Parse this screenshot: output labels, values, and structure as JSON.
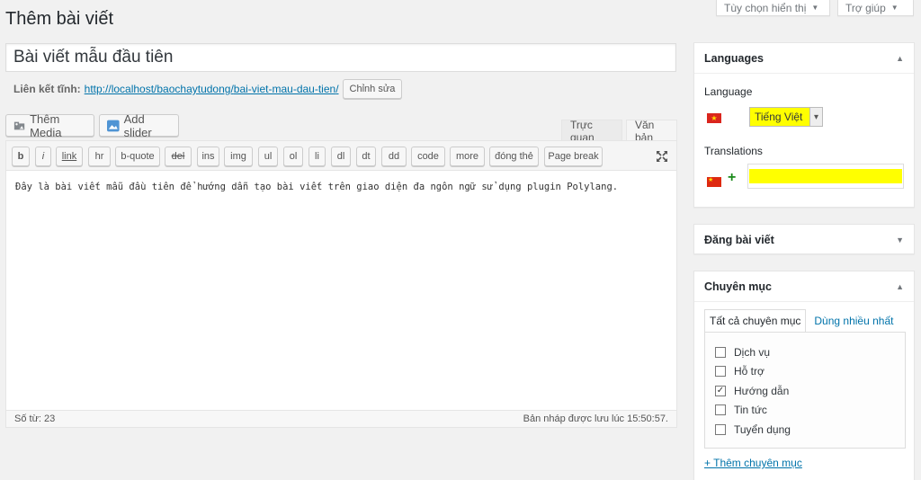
{
  "screen_meta": {
    "options_label": "Tùy chọn hiển thị",
    "help_label": "Trợ giúp"
  },
  "page": {
    "title": "Thêm bài viết"
  },
  "post": {
    "title": "Bài viết mẫu đầu tiên",
    "permalink_label": "Liên kết tĩnh:",
    "permalink_base": "http://localhost/baochaytudong/",
    "permalink_slug": "bai-viet-mau-dau-tien",
    "permalink_trailing": "/",
    "edit_button": "Chỉnh sửa"
  },
  "media_buttons": {
    "add_media": "Thêm Media",
    "add_slider": "Add slider"
  },
  "editor": {
    "tab_visual": "Trực quan",
    "tab_text": "Văn bản",
    "quicktags": [
      "b",
      "i",
      "link",
      "hr",
      "b-quote",
      "del",
      "ins",
      "img",
      "ul",
      "ol",
      "li",
      "dl",
      "dt",
      "dd",
      "code",
      "more",
      "đóng thẻ",
      "Page break"
    ],
    "content": "Đây là bài viết mẫu đầu tiên để hướng dẫn tạo bài viết trên giao diện đa ngôn ngữ sử dụng plugin Polylang.",
    "word_count": "Số từ: 23",
    "draft_saved": "Bản nháp được lưu lúc 15:50:57."
  },
  "languages_box": {
    "title": "Languages",
    "language_label": "Language",
    "selected_language": "Tiếng Việt",
    "translations_label": "Translations"
  },
  "publish_box": {
    "title": "Đăng bài viết"
  },
  "categories_box": {
    "title": "Chuyên mục",
    "tab_all": "Tất cả chuyên mục",
    "tab_popular": "Dùng nhiều nhất",
    "items": [
      {
        "label": "Dịch vụ",
        "checked": false
      },
      {
        "label": "Hỗ trợ",
        "checked": false
      },
      {
        "label": "Hướng dẫn",
        "checked": true
      },
      {
        "label": "Tin tức",
        "checked": false
      },
      {
        "label": "Tuyển dụng",
        "checked": false
      }
    ],
    "add_new": "+ Thêm chuyên mục"
  },
  "colors": {
    "link": "#0073aa",
    "highlight": "#ffff00",
    "add_green": "#1a8a1a"
  }
}
